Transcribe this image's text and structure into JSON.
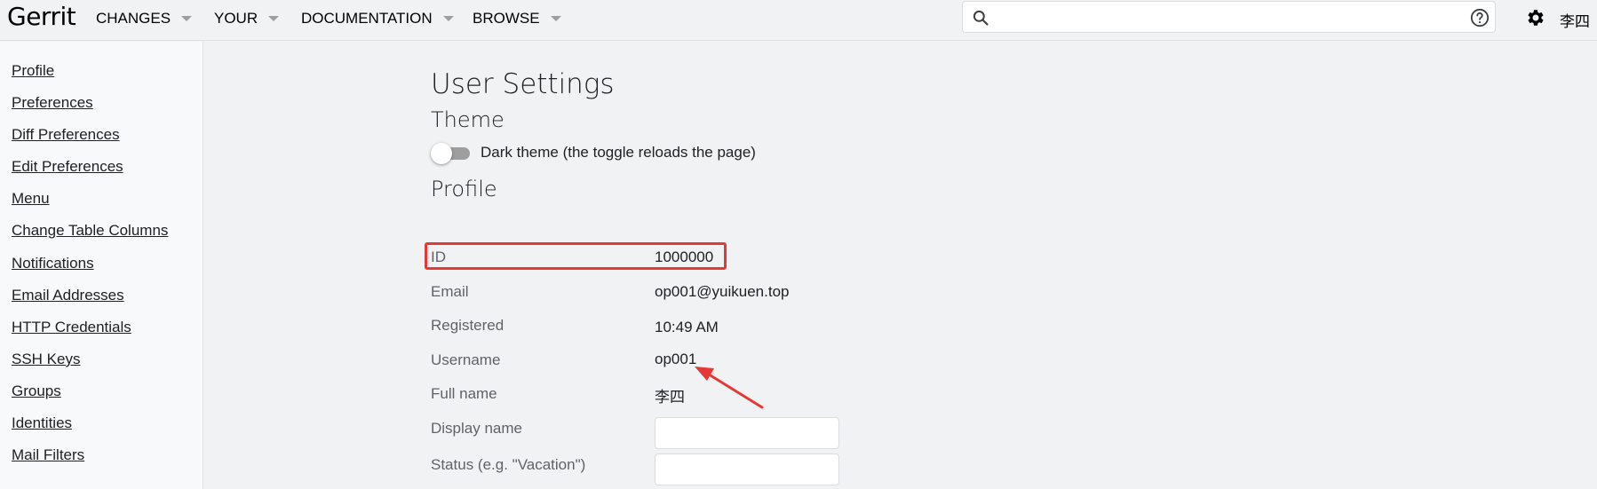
{
  "app": {
    "logo": "Gerrit"
  },
  "nav": [
    {
      "label": "CHANGES"
    },
    {
      "label": "YOUR"
    },
    {
      "label": "DOCUMENTATION"
    },
    {
      "label": "BROWSE"
    }
  ],
  "search": {
    "value": "",
    "placeholder": ""
  },
  "user": {
    "name": "李四"
  },
  "sidebar": {
    "items": [
      {
        "label": "Profile"
      },
      {
        "label": "Preferences"
      },
      {
        "label": "Diff Preferences"
      },
      {
        "label": "Edit Preferences"
      },
      {
        "label": "Menu"
      },
      {
        "label": "Change Table Columns"
      },
      {
        "label": "Notifications"
      },
      {
        "label": "Email Addresses"
      },
      {
        "label": "HTTP Credentials"
      },
      {
        "label": "SSH Keys"
      },
      {
        "label": "Groups"
      },
      {
        "label": "Identities"
      },
      {
        "label": "Mail Filters"
      }
    ]
  },
  "main": {
    "title": "User Settings",
    "theme": {
      "heading": "Theme",
      "toggle_label": "Dark theme (the toggle reloads the page)",
      "dark_theme_enabled": false
    },
    "profile": {
      "heading": "Profile",
      "rows": [
        {
          "label": "ID",
          "value": "1000000"
        },
        {
          "label": "Email",
          "value": "op001@yuikuen.top"
        },
        {
          "label": "Registered",
          "value": "10:49 AM"
        },
        {
          "label": "Username",
          "value": "op001"
        },
        {
          "label": "Full name",
          "value": "李四"
        },
        {
          "label": "Display name",
          "value": ""
        },
        {
          "label": "Status (e.g. \"Vacation\")",
          "value": ""
        }
      ]
    }
  },
  "colors": {
    "accent_highlight": "#e53935",
    "background": "#f1f2f3",
    "sidebar_background": "#f8f9fa"
  }
}
